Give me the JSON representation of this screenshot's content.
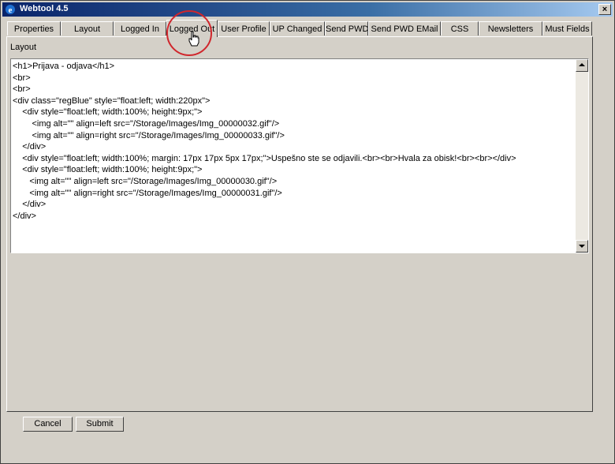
{
  "window": {
    "title": "Webtool 4.5",
    "close_glyph": "×",
    "icon": "ie-icon"
  },
  "tabs": [
    {
      "label": "Properties"
    },
    {
      "label": "Layout"
    },
    {
      "label": "Logged In"
    },
    {
      "label": "Logged Out",
      "active": true
    },
    {
      "label": "User Profile"
    },
    {
      "label": "UP Changed"
    },
    {
      "label": "Send PWD"
    },
    {
      "label": "Send PWD EMail"
    },
    {
      "label": "CSS"
    },
    {
      "label": "Newsletters"
    },
    {
      "label": "Must Fields"
    }
  ],
  "panel": {
    "label": "Layout",
    "code": "<h1>Prijava - odjava</h1>\n<br>\n<br>\n<div class=\"regBlue\" style=\"float:left; width:220px\">\n    <div style=\"float:left; width:100%; height:9px;\">\n        <img alt=\"\" align=left src=\"/Storage/Images/Img_00000032.gif\"/>\n        <img alt=\"\" align=right src=\"/Storage/Images/Img_00000033.gif\"/>\n    </div>\n    <div style=\"float:left; width:100%; margin: 17px 17px 5px 17px;\">Uspešno ste se odjavili.<br><br>Hvala za obisk!<br><br></div>\n    <div style=\"float:left; width:100%; height:9px;\">\n       <img alt=\"\" align=left src=\"/Storage/Images/Img_00000030.gif\"/>\n       <img alt=\"\" align=right src=\"/Storage/Images/Img_00000031.gif\"/>\n    </div>\n</div>"
  },
  "buttons": {
    "cancel": "Cancel",
    "submit": "Submit"
  },
  "colors": {
    "titlebar": "#0a246a",
    "highlight_circle": "#d0262c",
    "face": "#d4d0c8"
  }
}
